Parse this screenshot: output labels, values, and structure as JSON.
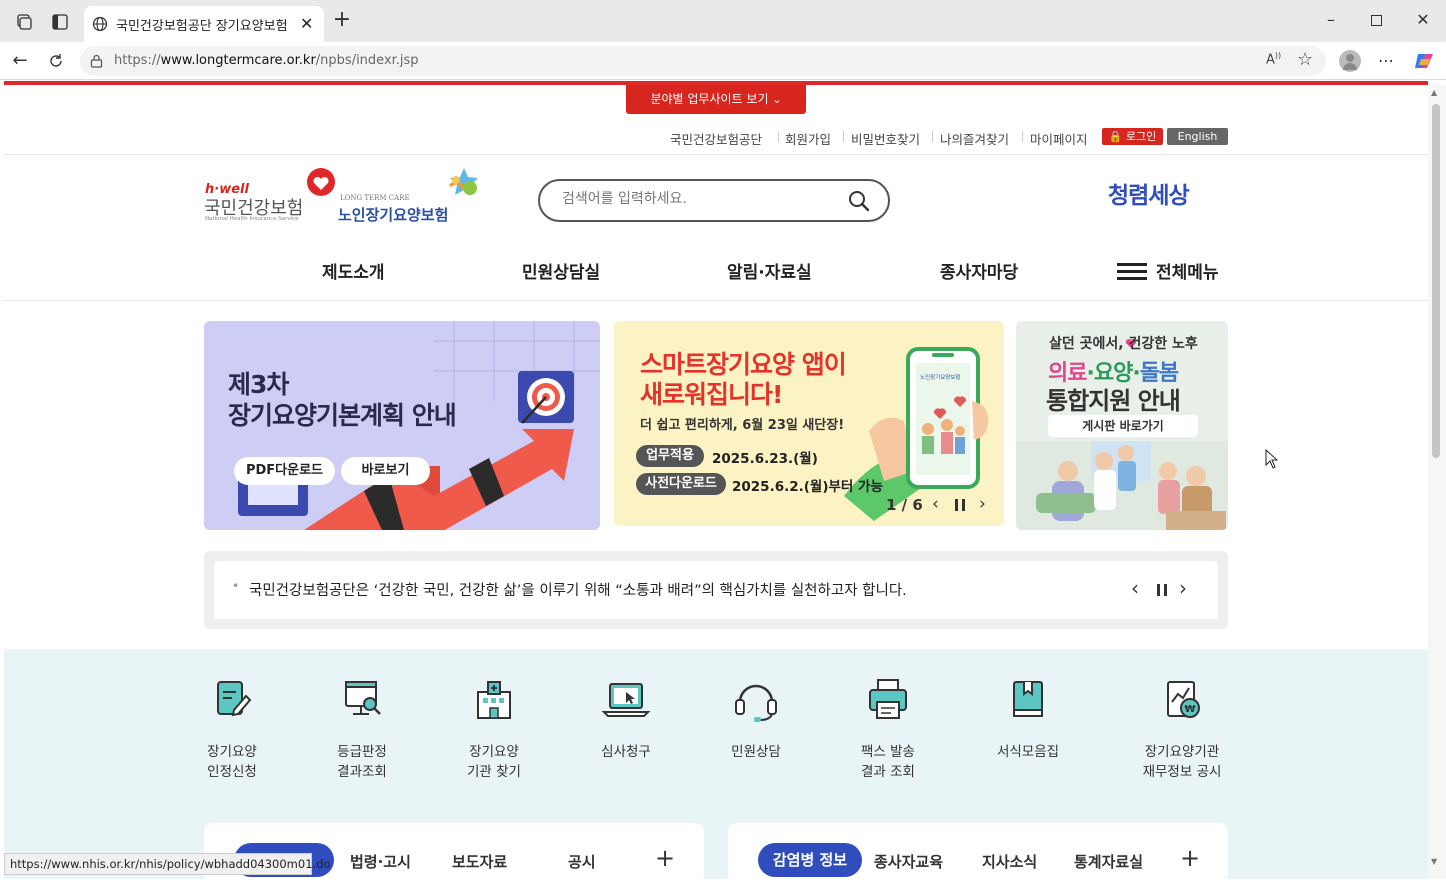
{
  "browser": {
    "tab_title": "국민건강보험공단 장기요양보험",
    "url_prefix": "https://",
    "url_domain": "www.longtermcare.or.kr",
    "url_path": "/npbs/indexr.jsp",
    "status_url": "https://www.nhis.or.kr/nhis/policy/wbhadd04300m01.do"
  },
  "header": {
    "field_site_button": "분야별 업무사이트 보기",
    "util_links": [
      "국민건강보험공단",
      "회원가입",
      "비밀번호찾기",
      "나의즐겨찾기",
      "마이페이지"
    ],
    "login": "로그인",
    "english": "English",
    "logo_hwell": "h·well",
    "logo_nhis": "국민건강보험",
    "logo_nhis_en": "National Health Insurance Service",
    "logo_ltc_en": "LONG TERM CARE",
    "logo_ltc": "노인장기요양보험",
    "search_placeholder": "검색어를 입력하세요.",
    "slogan": "청렴세상"
  },
  "nav": {
    "items": [
      "제도소개",
      "민원상담실",
      "알림·자료실",
      "종사자마당"
    ],
    "all_menu": "전체메뉴"
  },
  "banners": {
    "b1": {
      "line1": "제3차",
      "line2": "장기요양기본계획 안내",
      "btn1": "PDF다운로드",
      "btn2": "바로보기"
    },
    "b2": {
      "line1": "스마트장기요양 앱이",
      "line2": "새로워집니다!",
      "sub": "더 쉽고 편리하게, 6월 23일 새단장!",
      "tag1": "업무적용",
      "date1": "2025.6.23.(월)",
      "tag2": "사전다운로드",
      "date2": "2025.6.2.(월)부터 가능",
      "counter": "1 / 6",
      "app_label": "노인장기요양보험"
    },
    "b3": {
      "line1": "살던 곳에서, 건강한 노후",
      "line2a": "의료",
      "line2b": "요양",
      "line2c": "돌봄",
      "dot": "·",
      "line3": "통합지원 안내",
      "btn": "게시판 바로가기"
    }
  },
  "notice": {
    "text": "국민건강보험공단은 ‘건강한 국민, 건강한 삶’을 이루기 위해 “소통과 배려”의 핵심가치를 실천하고자 합니다."
  },
  "quick": [
    {
      "l1": "장기요양",
      "l2": "인정신청",
      "icon": "application-pen-icon"
    },
    {
      "l1": "등급판정",
      "l2": "결과조회",
      "icon": "monitor-search-icon"
    },
    {
      "l1": "장기요양",
      "l2": "기관 찾기",
      "icon": "hospital-icon"
    },
    {
      "l1": "심사청구",
      "l2": "",
      "icon": "laptop-cursor-icon"
    },
    {
      "l1": "민원상담",
      "l2": "",
      "icon": "headset-icon"
    },
    {
      "l1": "팩스 발송",
      "l2": "결과 조회",
      "icon": "fax-icon"
    },
    {
      "l1": "서식모음집",
      "l2": "",
      "icon": "book-icon"
    },
    {
      "l1": "장기요양기관",
      "l2": "재무정보 공시",
      "icon": "finance-report-icon"
    }
  ],
  "board_left": {
    "tabs": [
      "법령·고시",
      "보도자료",
      "공시"
    ],
    "more": "+"
  },
  "board_right": {
    "active": "감염병 정보",
    "tabs": [
      "종사자교육",
      "지사소식",
      "통계자료실"
    ],
    "more": "+"
  },
  "colors": {
    "brand_red": "#d7261e",
    "nav_blue": "#2f4dbd",
    "quick_bg": "#e8f4f6"
  }
}
